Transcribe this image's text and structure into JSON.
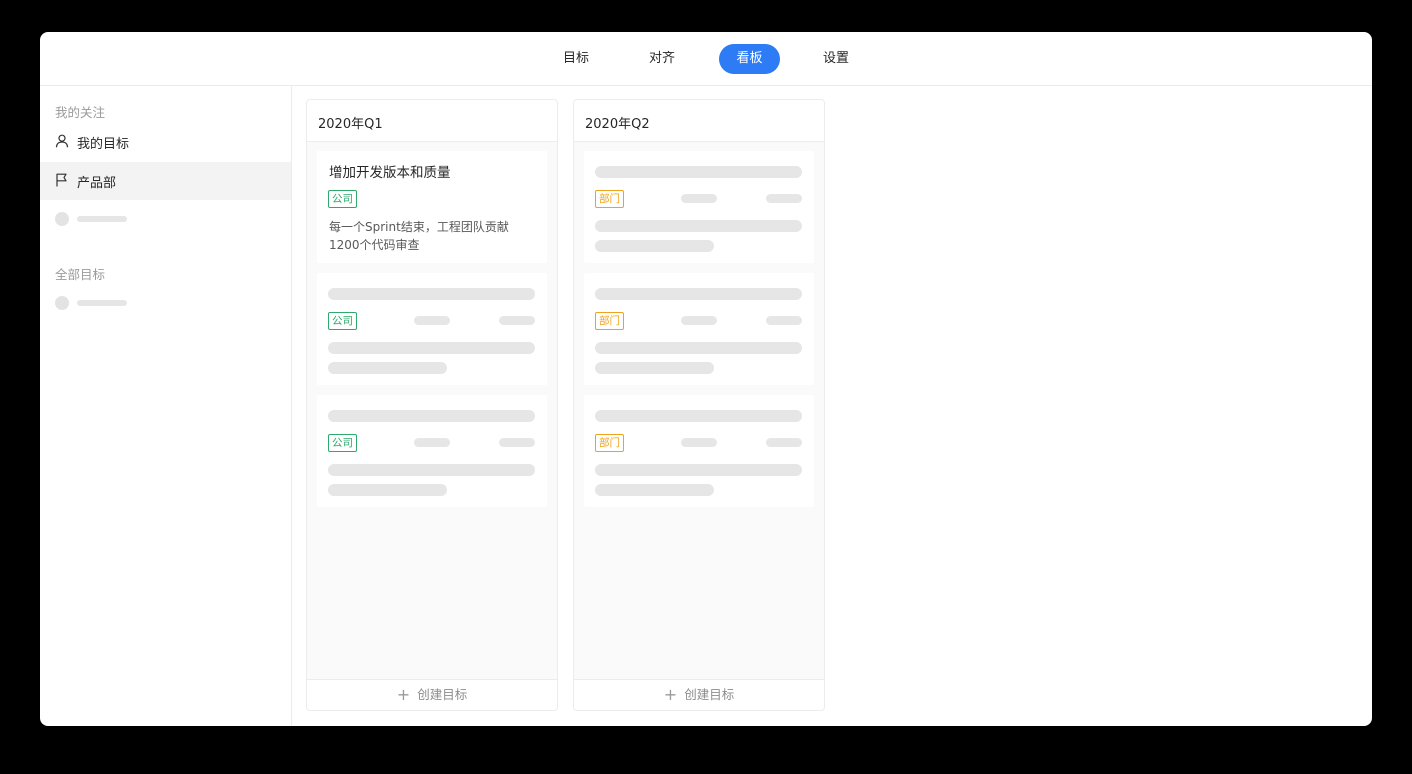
{
  "nav": {
    "tabs": [
      {
        "label": "目标"
      },
      {
        "label": "对齐"
      },
      {
        "label": "看板",
        "active": true
      },
      {
        "label": "设置"
      }
    ]
  },
  "sidebar": {
    "follow_title": "我的关注",
    "items": [
      {
        "label": "我的目标",
        "icon": "user-icon"
      },
      {
        "label": "产品部",
        "icon": "flag-icon",
        "active": true
      }
    ],
    "all_title": "全部目标"
  },
  "board": {
    "columns": [
      {
        "title": "2020年Q1",
        "create_label": "创建目标",
        "cards": [
          {
            "title": "增加开发版本和质量",
            "tag": "公司",
            "desc": "每一个Sprint结束，工程团队贡献1200个代码审查"
          },
          {
            "tag": "公司"
          },
          {
            "tag": "公司"
          }
        ]
      },
      {
        "title": "2020年Q2",
        "create_label": "创建目标",
        "cards": [
          {
            "tag": "部门"
          },
          {
            "tag": "部门"
          },
          {
            "tag": "部门"
          }
        ]
      }
    ]
  },
  "colors": {
    "accent": "#2e7bf6",
    "tag_company": "#2fa86c",
    "tag_department": "#efa21c"
  }
}
